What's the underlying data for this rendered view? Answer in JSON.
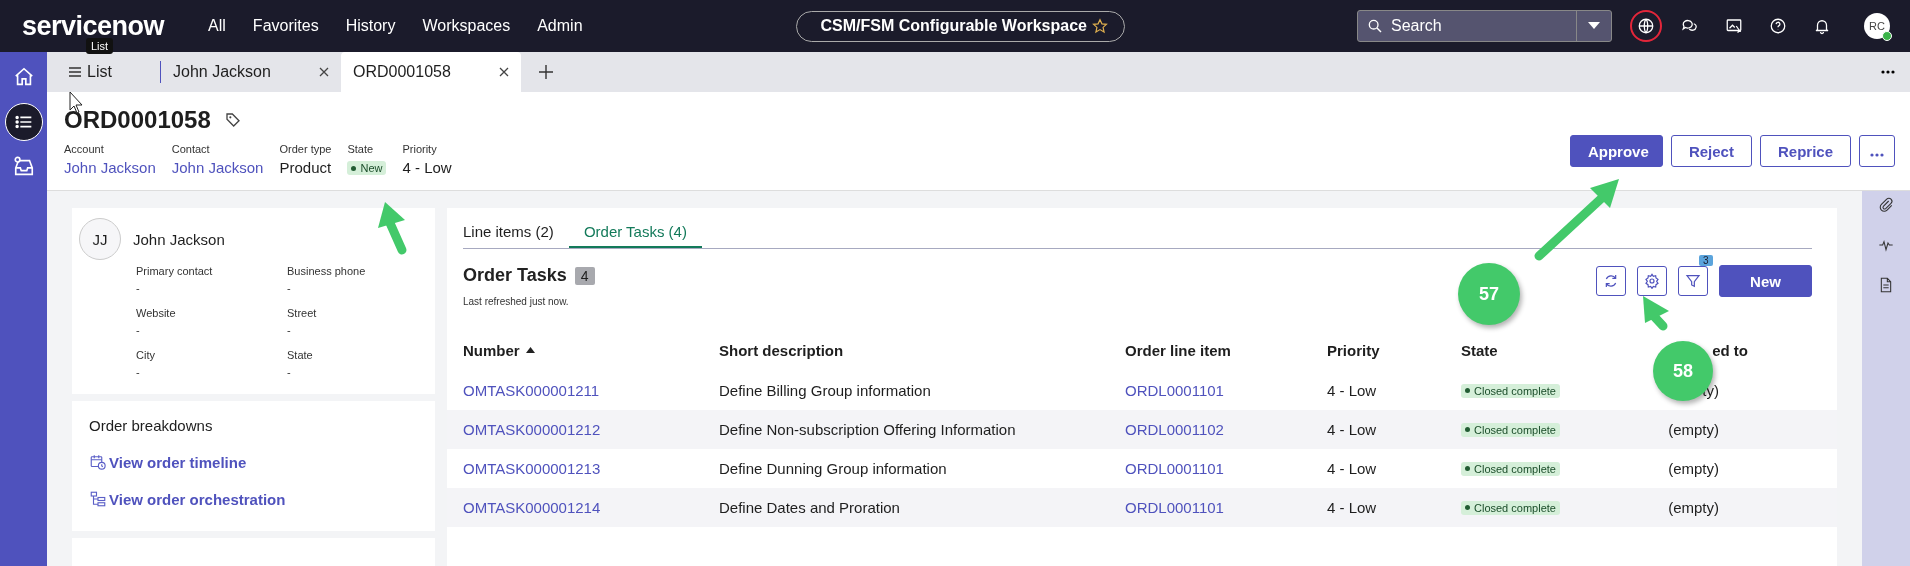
{
  "top_nav": {
    "logo": "servicenow",
    "tooltip": "List",
    "menu": [
      "All",
      "Favorites",
      "History",
      "Workspaces",
      "Admin"
    ],
    "workspace": "CSM/FSM Configurable Workspace",
    "search": {
      "placeholder": "Search"
    },
    "icons": [
      {
        "highlighted": true
      },
      {
        "highlighted": false
      },
      {
        "highlighted": false
      },
      {
        "highlighted": false
      },
      {
        "highlighted": false
      }
    ],
    "avatar": "RC"
  },
  "rail": [
    {
      "selected": false
    },
    {
      "selected": true
    },
    {
      "selected": false
    }
  ],
  "tabs": [
    {
      "label": "List",
      "selected": false,
      "kind": "list"
    },
    {
      "label": "John Jackson",
      "selected": false,
      "kind": "record"
    },
    {
      "label": "ORD0001058",
      "selected": true,
      "kind": "record"
    }
  ],
  "record": {
    "title": "ORD0001058",
    "fields": [
      {
        "label": "Account",
        "value": "John Jackson",
        "kind": "link"
      },
      {
        "label": "Contact",
        "value": "John Jackson",
        "kind": "link"
      },
      {
        "label": "Order type",
        "value": "Product",
        "kind": "text"
      },
      {
        "label": "State",
        "value": "New",
        "kind": "badge"
      },
      {
        "label": "Priority",
        "value": "4 - Low",
        "kind": "text"
      }
    ],
    "actions": [
      {
        "label": "Approve",
        "primary": true
      },
      {
        "label": "Reject",
        "primary": false
      },
      {
        "label": "Reprice",
        "primary": false
      }
    ]
  },
  "contact_card": {
    "initials": "JJ",
    "name": "John Jackson",
    "fields": [
      {
        "label": "Primary contact",
        "value": "-"
      },
      {
        "label": "Business phone",
        "value": "-"
      },
      {
        "label": "Website",
        "value": "-"
      },
      {
        "label": "Street",
        "value": "-"
      },
      {
        "label": "City",
        "value": "-"
      },
      {
        "label": "State",
        "value": "-"
      }
    ]
  },
  "breakdowns": {
    "title": "Order breakdowns",
    "links": [
      "View order timeline",
      "View order orchestration"
    ]
  },
  "related_tabs": [
    {
      "label": "Line items (2)",
      "selected": false
    },
    {
      "label": "Order Tasks (4)",
      "selected": true
    }
  ],
  "list": {
    "title": "Order Tasks",
    "count": "4",
    "refreshed": "Last refreshed just now.",
    "filter_count": "3",
    "new_button": "New",
    "columns": [
      "Number",
      "Short description",
      "Order line item",
      "Priority",
      "State",
      "ed to"
    ],
    "rows": [
      {
        "number": "OMTASK000001211",
        "description": "Define Billing Group information",
        "line_item": "ORDL0001101",
        "priority": "4 - Low",
        "state": "Closed complete",
        "assigned": "ty)"
      },
      {
        "number": "OMTASK000001212",
        "description": "Define Non-subscription Offering Information",
        "line_item": "ORDL0001102",
        "priority": "4 - Low",
        "state": "Closed complete",
        "assigned": "(empty)"
      },
      {
        "number": "OMTASK000001213",
        "description": "Define Dunning Group information",
        "line_item": "ORDL0001101",
        "priority": "4 - Low",
        "state": "Closed complete",
        "assigned": "(empty)"
      },
      {
        "number": "OMTASK000001214",
        "description": "Define Dates and Proration",
        "line_item": "ORDL0001101",
        "priority": "4 - Low",
        "state": "Closed complete",
        "assigned": "(empty)"
      }
    ]
  },
  "annotations": [
    {
      "label": "57"
    },
    {
      "label": "58"
    }
  ]
}
